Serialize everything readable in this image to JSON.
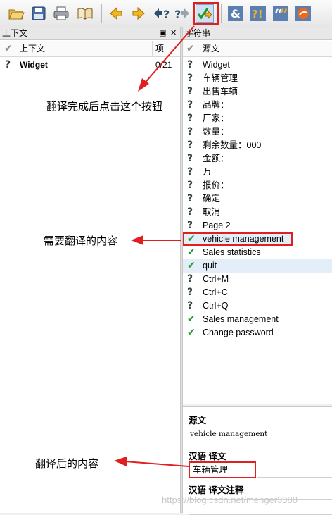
{
  "toolbar": {
    "icons": [
      "open-folder-icon",
      "save-icon",
      "print-icon",
      "phrase-book-icon",
      "prev-icon",
      "next-icon",
      "prev-unfinished-icon",
      "next-unfinished-icon",
      "done-and-next-icon",
      "accelerators-icon",
      "punctuation-check-icon",
      "phrase-match-icon",
      "place-markers-icon"
    ]
  },
  "context_panel": {
    "title": "上下文",
    "header_context": "上下文",
    "header_items": "项",
    "rows": [
      {
        "name": "Widget",
        "count": "0/21"
      }
    ]
  },
  "strings_panel": {
    "title": "字符串",
    "header_source": "源文",
    "rows": [
      {
        "text": "Widget",
        "status": "unfinished"
      },
      {
        "text": "车辆管理",
        "status": "unfinished"
      },
      {
        "text": "出售车辆",
        "status": "unfinished"
      },
      {
        "text": "品牌：",
        "status": "unfinished"
      },
      {
        "text": "厂家：",
        "status": "unfinished"
      },
      {
        "text": "数量：",
        "status": "unfinished"
      },
      {
        "text": "剩余数量：000",
        "status": "unfinished"
      },
      {
        "text": "金额：",
        "status": "unfinished"
      },
      {
        "text": "万",
        "status": "unfinished"
      },
      {
        "text": "报价：",
        "status": "unfinished"
      },
      {
        "text": "确定",
        "status": "unfinished"
      },
      {
        "text": "取消",
        "status": "unfinished"
      },
      {
        "text": "Page 2",
        "status": "unfinished"
      },
      {
        "text": "vehicle management",
        "status": "done"
      },
      {
        "text": "Sales statistics",
        "status": "done"
      },
      {
        "text": "quit",
        "status": "done"
      },
      {
        "text": "Ctrl+M",
        "status": "unfinished"
      },
      {
        "text": "Ctrl+C",
        "status": "unfinished"
      },
      {
        "text": "Ctrl+Q",
        "status": "unfinished"
      },
      {
        "text": "Sales management",
        "status": "done"
      },
      {
        "text": "Change password",
        "status": "done"
      }
    ]
  },
  "editor": {
    "source_label": "源文",
    "source_text": "vehicle management",
    "translation_label": "汉语  译文",
    "translation_value": "车辆管理",
    "comment_label": "汉语  译文注释"
  },
  "annotations": {
    "click_button": "翻译完成后点击这个按钮",
    "content_to_translate": "需要翻译的内容",
    "translated_content": "翻译后的内容"
  },
  "watermark": "https://blog.csdn.net/menger3388",
  "colors": {
    "annotation_red": "#e02020",
    "done_green": "#1c9a2c"
  }
}
